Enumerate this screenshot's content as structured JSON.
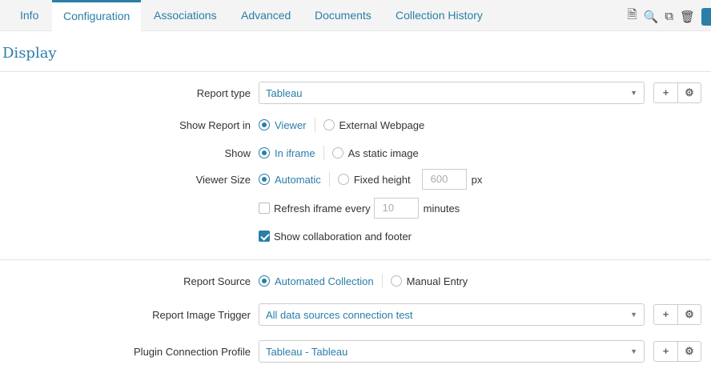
{
  "tabs": [
    {
      "label": "Info"
    },
    {
      "label": "Configuration"
    },
    {
      "label": "Associations"
    },
    {
      "label": "Advanced"
    },
    {
      "label": "Documents"
    },
    {
      "label": "Collection History"
    }
  ],
  "active_tab": "Configuration",
  "section_title": "Display",
  "report_type": {
    "label": "Report type",
    "value": "Tableau"
  },
  "show_report_in": {
    "label": "Show Report in",
    "options": [
      "Viewer",
      "External Webpage"
    ],
    "selected": "Viewer"
  },
  "show": {
    "label": "Show",
    "options": [
      "In iframe",
      "As static image"
    ],
    "selected": "In iframe"
  },
  "viewer_size": {
    "label": "Viewer Size",
    "options": [
      "Automatic",
      "Fixed height"
    ],
    "selected": "Automatic",
    "height_placeholder": "600",
    "unit": "px"
  },
  "refresh": {
    "label": "Refresh iframe every",
    "value_placeholder": "10",
    "unit": "minutes",
    "checked": false
  },
  "collab": {
    "label": "Show collaboration and footer",
    "checked": true
  },
  "report_source": {
    "label": "Report Source",
    "options": [
      "Automated Collection",
      "Manual Entry"
    ],
    "selected": "Automated Collection"
  },
  "image_trigger": {
    "label": "Report Image Trigger",
    "value": "All data sources connection test"
  },
  "plugin_profile": {
    "label": "Plugin Connection Profile",
    "value": "Tableau - Tableau"
  },
  "accent_color": "#2a7ea8"
}
